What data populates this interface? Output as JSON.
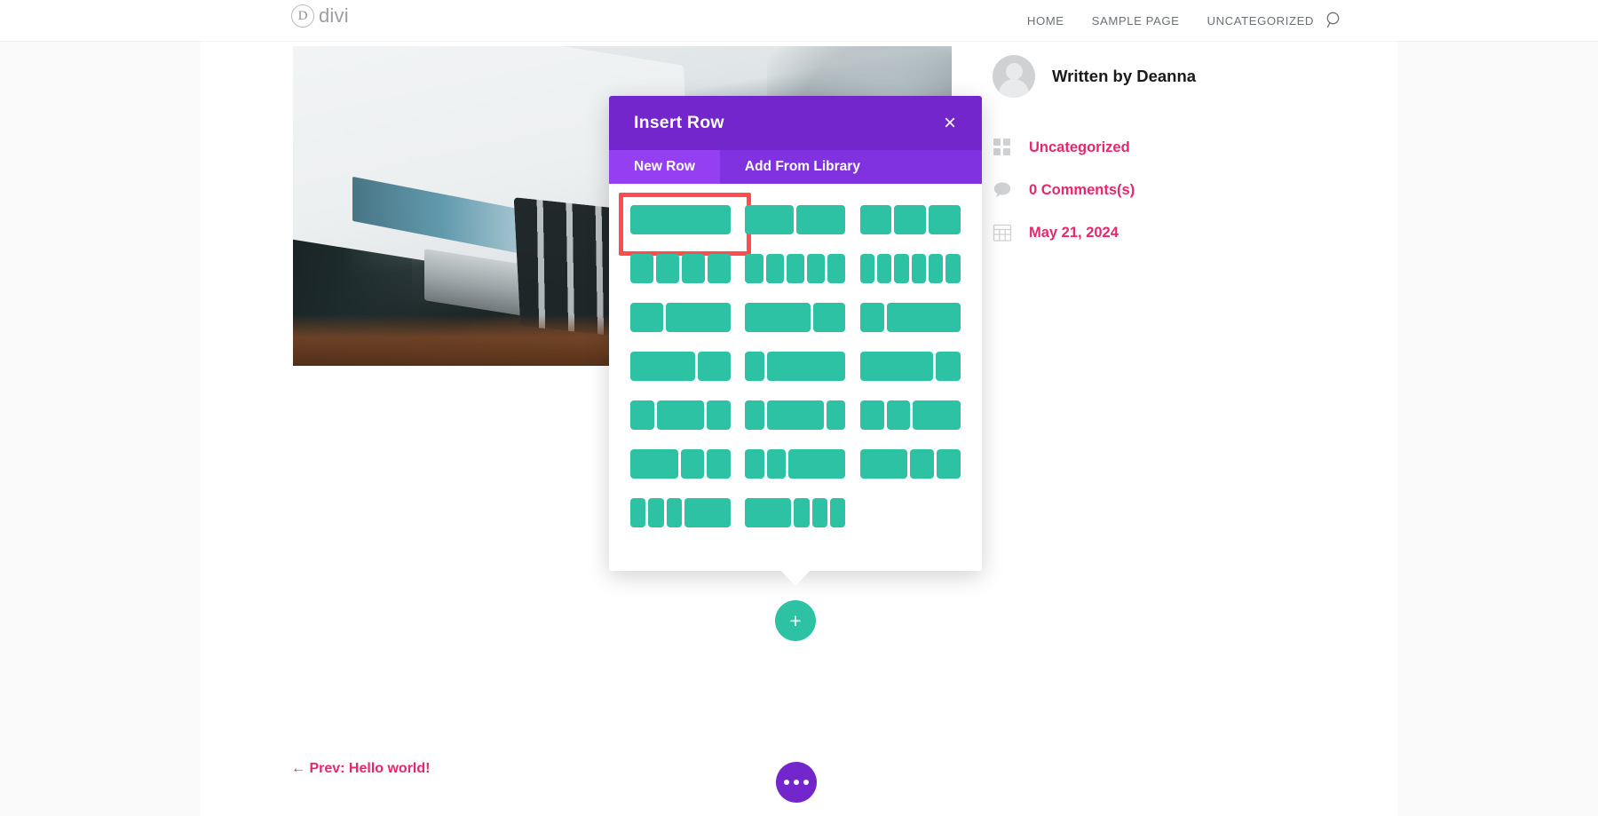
{
  "header": {
    "logo_letter": "D",
    "logo_text": "divi",
    "nav_items": [
      {
        "label": "HOME"
      },
      {
        "label": "SAMPLE PAGE"
      },
      {
        "label": "UNCATEGORIZED"
      }
    ],
    "search_icon": "search-icon"
  },
  "post_meta": {
    "author_label": "Written by Deanna",
    "rows": [
      {
        "icon": "grid-icon",
        "label": "Uncategorized"
      },
      {
        "icon": "comment-bubble-icon",
        "label": "0 Comments(s)"
      },
      {
        "icon": "calendar-icon",
        "label": "May 21, 2024"
      }
    ]
  },
  "modal": {
    "title": "Insert Row",
    "close_label": "×",
    "tabs": [
      {
        "label": "New Row",
        "active": true
      },
      {
        "label": "Add From Library",
        "active": false
      }
    ],
    "layouts": [
      {
        "name": "1-column",
        "widths": [
          100
        ],
        "highlighted": true
      },
      {
        "name": "2-column",
        "widths": [
          50,
          50
        ],
        "highlighted": false
      },
      {
        "name": "3-column",
        "widths": [
          33.33,
          33.33,
          33.33
        ],
        "highlighted": false
      },
      {
        "name": "4-column",
        "widths": [
          25,
          25,
          25,
          25
        ],
        "highlighted": false
      },
      {
        "name": "5-column",
        "widths": [
          20,
          20,
          20,
          20,
          20
        ],
        "highlighted": false
      },
      {
        "name": "6-column",
        "widths": [
          16.66,
          16.66,
          16.66,
          16.66,
          16.66,
          16.66
        ],
        "highlighted": false
      },
      {
        "name": "one-third-two-thirds",
        "widths": [
          33.33,
          66.66
        ],
        "highlighted": false
      },
      {
        "name": "two-thirds-one-third",
        "widths": [
          66.66,
          33.33
        ],
        "highlighted": false
      },
      {
        "name": "one-quarter-three-quarter",
        "widths": [
          25,
          75
        ],
        "highlighted": false
      },
      {
        "name": "two-thirds-one-third-b",
        "widths": [
          66.66,
          33.33
        ],
        "highlighted": false
      },
      {
        "name": "one-fifth-four-fifth",
        "widths": [
          20,
          80
        ],
        "highlighted": false
      },
      {
        "name": "three-quarter-one-quarter",
        "widths": [
          75,
          25
        ],
        "highlighted": false
      },
      {
        "name": "quarter-half-quarter",
        "widths": [
          25,
          50,
          25
        ],
        "highlighted": false
      },
      {
        "name": "fifth-three-fifth-fifth",
        "widths": [
          20,
          60,
          20
        ],
        "highlighted": false
      },
      {
        "name": "quarter-quarter-half",
        "widths": [
          25,
          25,
          50
        ],
        "highlighted": false
      },
      {
        "name": "half-quarter-quarter",
        "widths": [
          50,
          25,
          25
        ],
        "highlighted": false
      },
      {
        "name": "fifth-fifth-three-fifth",
        "widths": [
          20,
          20,
          60
        ],
        "highlighted": false
      },
      {
        "name": "half-quarter-quarter-b",
        "widths": [
          50,
          25,
          25
        ],
        "highlighted": false
      },
      {
        "name": "sixth-sixth-sixth-half",
        "widths": [
          16.66,
          16.66,
          16.66,
          50
        ],
        "highlighted": false
      },
      {
        "name": "half-sixth-sixth-sixth",
        "widths": [
          50,
          16.66,
          16.66,
          16.66
        ],
        "highlighted": false
      }
    ]
  },
  "buttons": {
    "add_row_label": "+",
    "more_options_icon": "ellipsis-icon"
  },
  "footer": {
    "prev_post_label": "← Prev: Hello world!"
  },
  "colors": {
    "purple": "#7226cc",
    "purple_tab": "#8132e0",
    "purple_tab_active": "#9440f2",
    "teal": "#2ec2a5",
    "pink": "#e8266f",
    "highlight_red": "#ff4d4d"
  }
}
